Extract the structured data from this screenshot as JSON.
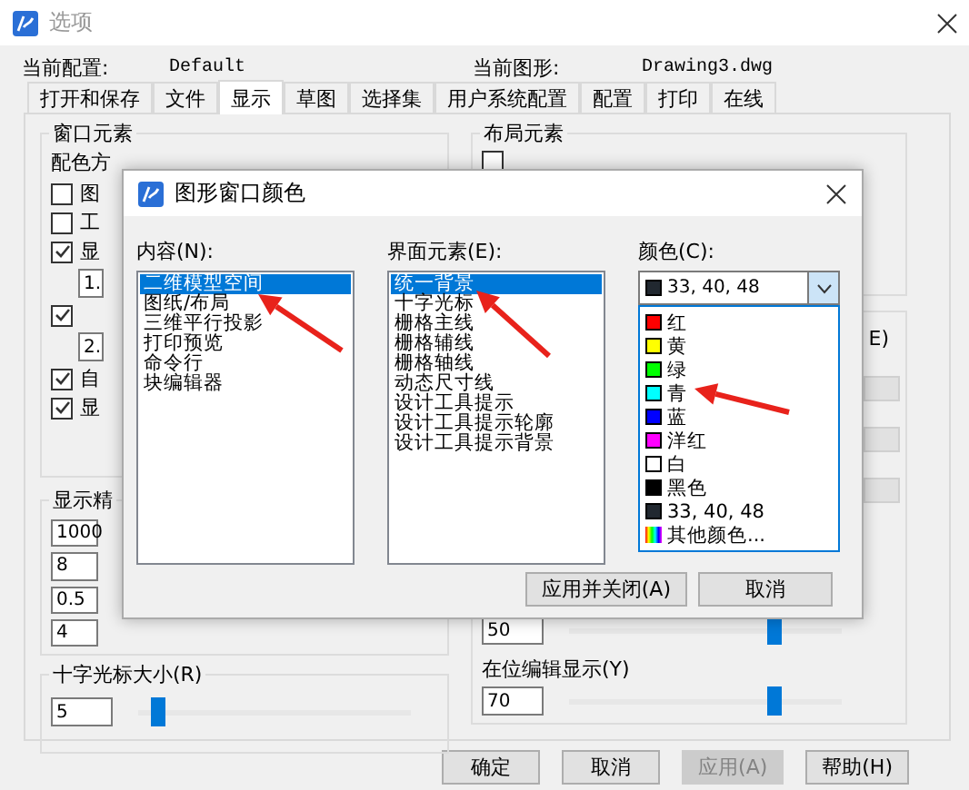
{
  "window": {
    "title": "选项"
  },
  "header": {
    "profile_label": "当前配置:",
    "profile": "Default",
    "drawing_label": "当前图形:",
    "drawing": "Drawing3.dwg"
  },
  "tabs": [
    {
      "label": "打开和保存",
      "selected": false
    },
    {
      "label": "文件",
      "selected": false
    },
    {
      "label": "显示",
      "selected": true
    },
    {
      "label": "草图",
      "selected": false
    },
    {
      "label": "选择集",
      "selected": false
    },
    {
      "label": "用户系统配置",
      "selected": false
    },
    {
      "label": "配置",
      "selected": false
    },
    {
      "label": "打印",
      "selected": false
    },
    {
      "label": "在线",
      "selected": false
    }
  ],
  "display_tab": {
    "window_elements": {
      "title": "窗口元素",
      "scheme_label": "配色方",
      "rows": [
        {
          "kind": "checkbox",
          "label": "图",
          "checked": false
        },
        {
          "kind": "checkbox",
          "label": "工",
          "checked": false
        },
        {
          "kind": "checkbox",
          "label": "显",
          "checked": true
        },
        {
          "kind": "field",
          "value": "1."
        },
        {
          "kind": "checkbox",
          "checked": true
        },
        {
          "kind": "field",
          "value": "2."
        },
        {
          "kind": "checkbox",
          "label": "自",
          "checked": true
        },
        {
          "kind": "checkbox",
          "label": "显",
          "checked": true
        }
      ]
    },
    "precision": {
      "title": "显示精",
      "fields": [
        "1000",
        "8",
        "0.5",
        "4"
      ]
    },
    "crosshair": {
      "title": "十字光标大小(R)",
      "value": "5",
      "level": 0.05
    },
    "layout_elements": {
      "title": "布局元素",
      "checked": false
    },
    "fade": {
      "label": "E)",
      "value": "50",
      "level": 0.77
    },
    "inplace": {
      "label": "在位编辑显示(Y)",
      "value": "70",
      "level": 0.77
    }
  },
  "buttons": [
    {
      "label": "确定",
      "disabled": false
    },
    {
      "label": "取消",
      "disabled": false
    },
    {
      "label": "应用(A)",
      "disabled": true
    },
    {
      "label": "帮助(H)",
      "disabled": false
    }
  ],
  "dialog": {
    "title": "图形窗口颜色",
    "context_label": "内容(N):",
    "contexts": [
      {
        "label": "二维模型空间",
        "selected": true
      },
      {
        "label": "图纸/布局",
        "selected": false
      },
      {
        "label": "三维平行投影",
        "selected": false
      },
      {
        "label": "打印预览",
        "selected": false
      },
      {
        "label": "命令行",
        "selected": false
      },
      {
        "label": "块编辑器",
        "selected": false
      }
    ],
    "element_label": "界面元素(E):",
    "elements": [
      {
        "label": "统一背景",
        "selected": true
      },
      {
        "label": "十字光标",
        "selected": false
      },
      {
        "label": "栅格主线",
        "selected": false
      },
      {
        "label": "栅格辅线",
        "selected": false
      },
      {
        "label": "栅格轴线",
        "selected": false
      },
      {
        "label": "动态尺寸线",
        "selected": false
      },
      {
        "label": "设计工具提示",
        "selected": false
      },
      {
        "label": "设计工具提示轮廓",
        "selected": false
      },
      {
        "label": "设计工具提示背景",
        "selected": false
      }
    ],
    "color_label": "颜色(C):",
    "color": {
      "label": "33, 40, 48",
      "color": "#212830"
    },
    "color_options": [
      {
        "kind": "color",
        "label": "红",
        "color": "#ff0000"
      },
      {
        "kind": "color",
        "label": "黄",
        "color": "#ffff00"
      },
      {
        "kind": "color",
        "label": "绿",
        "color": "#00ff00"
      },
      {
        "kind": "color",
        "label": "青",
        "color": "#00ffff"
      },
      {
        "kind": "color",
        "label": "蓝",
        "color": "#0000ff"
      },
      {
        "kind": "color",
        "label": "洋红",
        "color": "#ff00ff"
      },
      {
        "kind": "color",
        "label": "白",
        "color": "#ffffff"
      },
      {
        "kind": "color",
        "label": "黑色",
        "color": "#000000"
      },
      {
        "kind": "color",
        "label": "33, 40, 48",
        "color": "#212830"
      },
      {
        "kind": "more",
        "label": "其他颜色..."
      }
    ],
    "buttons": [
      "应用并关闭(A)",
      "取消"
    ]
  }
}
